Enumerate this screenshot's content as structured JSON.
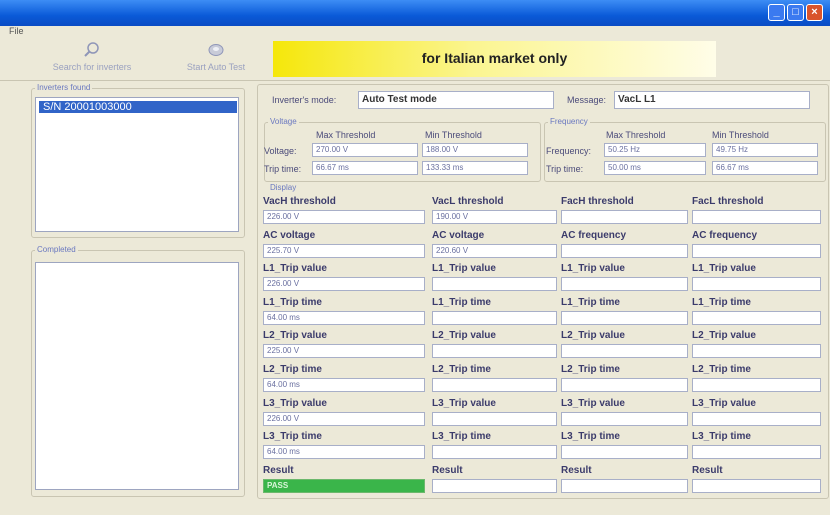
{
  "window": {
    "min_glyph": "_",
    "max_glyph": "□",
    "close_glyph": "×"
  },
  "menu": {
    "file": "File"
  },
  "toolbar": {
    "search_label": "Search for inverters",
    "auto_label": "Start Auto Test",
    "banner": "for Italian market only"
  },
  "sidebar": {
    "found_title": "Inverters found",
    "inverter_sn": "S/N 20001003000",
    "completed_title": "Completed"
  },
  "main": {
    "mode_label": "Inverter's mode:",
    "mode_value": "Auto Test mode",
    "message_label": "Message:",
    "message_value": "VacL L1"
  },
  "voltage": {
    "title": "Voltage",
    "max_header": "Max Threshold",
    "min_header": "Min Threshold",
    "row1_label": "Voltage:",
    "row1_max": "270.00 V",
    "row1_min": "188.00 V",
    "row2_label": "Trip time:",
    "row2_max": "66.67 ms",
    "row2_min": "133.33 ms"
  },
  "frequency": {
    "title": "Frequency",
    "max_header": "Max Threshold",
    "min_header": "Min Threshold",
    "row1_label": "Frequency:",
    "row1_max": "50.25 Hz",
    "row1_min": "49.75 Hz",
    "row2_label": "Trip time:",
    "row2_max": "50.00 ms",
    "row2_min": "66.67 ms"
  },
  "display": {
    "title": "Display",
    "rows": [
      {
        "labels": [
          "VacH threshold",
          "VacL threshold",
          "FacH threshold",
          "FacL threshold"
        ],
        "values": [
          "226.00 V",
          "190.00 V",
          "",
          ""
        ]
      },
      {
        "labels": [
          "AC voltage",
          "AC voltage",
          "AC frequency",
          "AC frequency"
        ],
        "values": [
          "225.70 V",
          "220.60 V",
          "",
          ""
        ]
      },
      {
        "labels": [
          "L1_Trip value",
          "L1_Trip value",
          "L1_Trip value",
          "L1_Trip value"
        ],
        "values": [
          "226.00 V",
          "",
          "",
          ""
        ]
      },
      {
        "labels": [
          "L1_Trip time",
          "L1_Trip time",
          "L1_Trip time",
          "L1_Trip time"
        ],
        "values": [
          "64.00 ms",
          "",
          "",
          ""
        ]
      },
      {
        "labels": [
          "L2_Trip value",
          "L2_Trip value",
          "L2_Trip value",
          "L2_Trip value"
        ],
        "values": [
          "225.00 V",
          "",
          "",
          ""
        ]
      },
      {
        "labels": [
          "L2_Trip time",
          "L2_Trip time",
          "L2_Trip time",
          "L2_Trip time"
        ],
        "values": [
          "64.00 ms",
          "",
          "",
          ""
        ]
      },
      {
        "labels": [
          "L3_Trip value",
          "L3_Trip value",
          "L3_Trip value",
          "L3_Trip value"
        ],
        "values": [
          "226.00 V",
          "",
          "",
          ""
        ]
      },
      {
        "labels": [
          "L3_Trip time",
          "L3_Trip time",
          "L3_Trip time",
          "L3_Trip time"
        ],
        "values": [
          "64.00 ms",
          "",
          "",
          ""
        ]
      },
      {
        "labels": [
          "Result",
          "Result",
          "Result",
          "Result"
        ],
        "values": [
          "PASS",
          "",
          "",
          ""
        ]
      }
    ]
  },
  "colors": {
    "title_bar": "#0a5ad8",
    "selection": "#3164c8",
    "banner": "#f5e70a",
    "pass": "#3ab54a"
  },
  "icons": {
    "search": "magnifier-icon",
    "auto_test": "disc-icon"
  }
}
